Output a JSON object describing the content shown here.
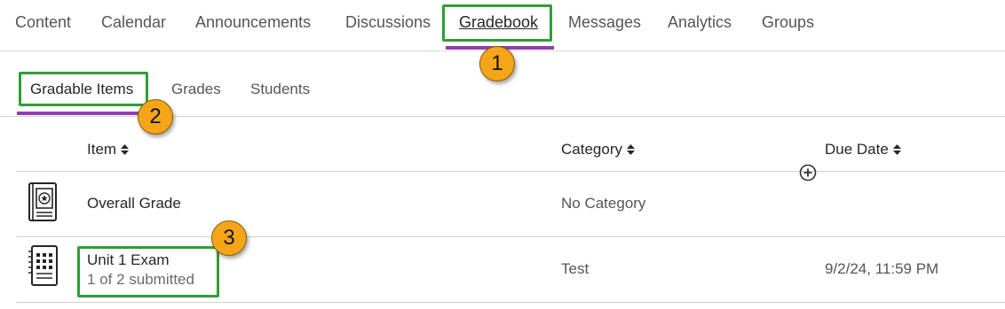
{
  "course_nav": {
    "tabs": [
      {
        "label": "Content"
      },
      {
        "label": "Calendar"
      },
      {
        "label": "Announcements"
      },
      {
        "label": "Discussions"
      },
      {
        "label": "Gradebook"
      },
      {
        "label": "Messages"
      },
      {
        "label": "Analytics"
      },
      {
        "label": "Groups"
      }
    ],
    "active": "Gradebook"
  },
  "gradebook_nav": {
    "tabs": [
      {
        "label": "Gradable Items"
      },
      {
        "label": "Grades"
      },
      {
        "label": "Students"
      }
    ],
    "active": "Gradable Items"
  },
  "table": {
    "headers": {
      "item": "Item",
      "category": "Category",
      "due_date": "Due Date"
    },
    "rows": [
      {
        "icon": "overall-grade-icon",
        "title": "Overall Grade",
        "subtitle": "",
        "category": "No Category",
        "due": ""
      },
      {
        "icon": "test-calculator-icon",
        "title": "Unit 1 Exam",
        "subtitle": "1 of 2 submitted",
        "category": "Test",
        "due": "9/2/24, 11:59 PM"
      }
    ]
  },
  "annotations": {
    "badge_1": "1",
    "badge_2": "2",
    "badge_3": "3"
  },
  "colors": {
    "accent": "#8e3fb0",
    "highlight": "#2e9e37",
    "badge": "#f5a618"
  }
}
